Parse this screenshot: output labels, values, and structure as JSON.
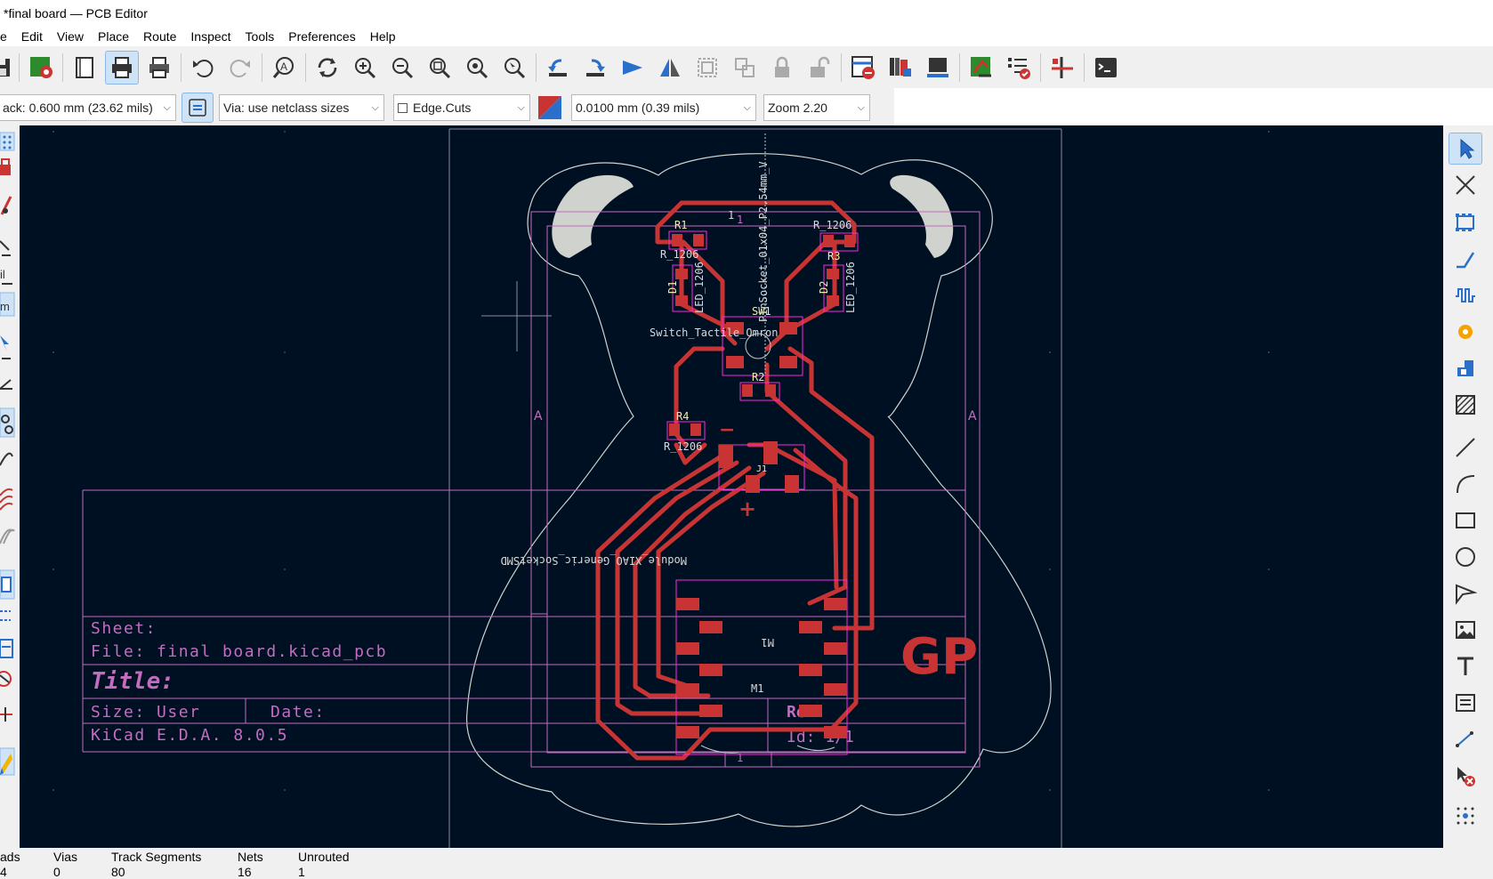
{
  "window": {
    "title": "*final board — PCB Editor"
  },
  "menu": [
    "e",
    "Edit",
    "View",
    "Place",
    "Route",
    "Inspect",
    "Tools",
    "Preferences",
    "Help"
  ],
  "toolbar2": {
    "track": "ack: 0.600 mm (23.62 mils)",
    "via": "Via: use netclass sizes",
    "layer": "Edge.Cuts",
    "grid": "0.0100 mm (0.39 mils)",
    "zoom": "Zoom 2.20"
  },
  "pcb": {
    "refs": {
      "r1": "R1",
      "r1_val": "R_1206",
      "r3": "R3",
      "r3_val": "R_1206",
      "d1": "D1",
      "d1_val": "LED_1206",
      "d2": "D2",
      "d2_val": "LED_1206",
      "sw1": "SW1",
      "sw1_val": "Switch_Tactile_Omron",
      "r2": "R2",
      "r4": "R4",
      "r4_val": "R_1206",
      "j1": "J1",
      "pinsocket": "PinSocket_01x04_P2.54mm_V",
      "module": "Module_XIAO_Generic_SocketSMD",
      "m1": "M1",
      "pin1": "1",
      "minus": "−",
      "plus": "+",
      "logo": "GP",
      "zone_a": "A"
    },
    "titleblock": {
      "sheet": "Sheet:",
      "file": "File: final board.kicad_pcb",
      "title": "Title:",
      "size": "Size: User",
      "date": "Date:",
      "rev": "Rev:",
      "id": "Id: 1/1",
      "kicad": "KiCad E.D.A. 8.0.5"
    }
  },
  "status": {
    "pads_label": "ads",
    "pads_value": "4",
    "vias_label": "Vias",
    "vias_value": "0",
    "tracks_label": "Track Segments",
    "tracks_value": "80",
    "nets_label": "Nets",
    "nets_value": "16",
    "unrouted_label": "Unrouted",
    "unrouted_value": "1"
  },
  "colors": {
    "canvas": "#001023",
    "copper": "#c83434",
    "silkscreen": "#f2eda1",
    "courtyard": "#ff26e2",
    "edge_cuts": "#d0d2cd",
    "drawing_sheet": "#c46cbf",
    "fab": "#a0a0a0"
  }
}
